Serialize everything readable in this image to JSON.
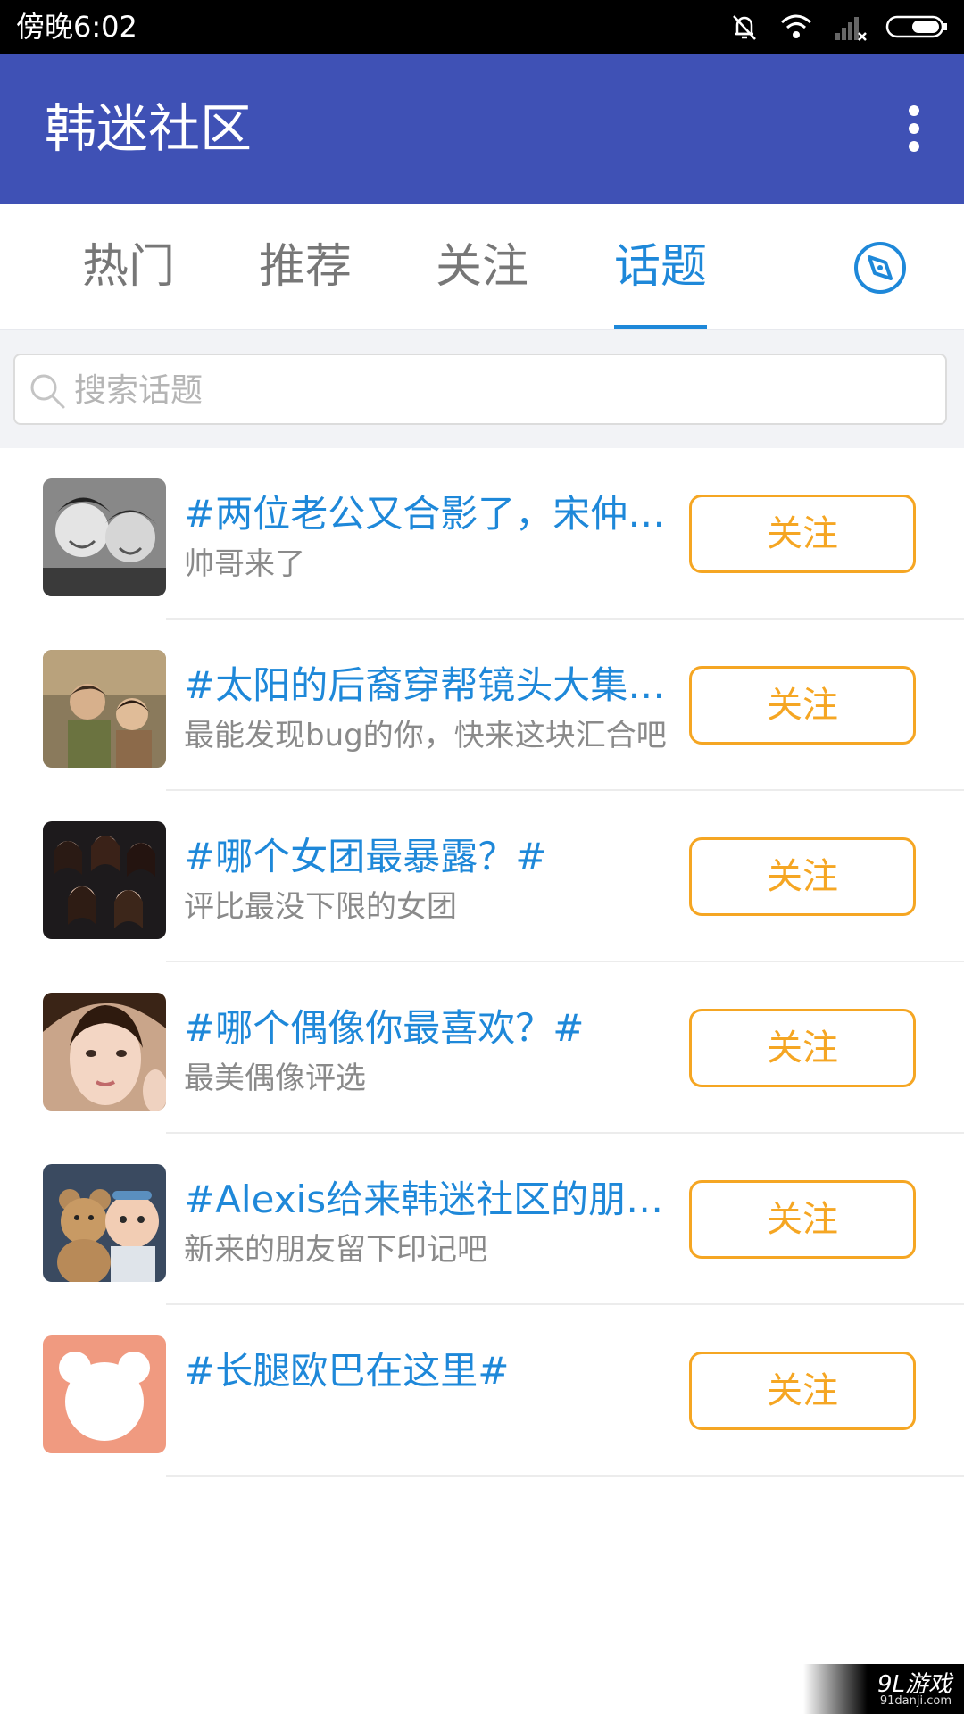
{
  "status_bar": {
    "time": "傍晚6:02"
  },
  "app_bar": {
    "title": "韩迷社区"
  },
  "tabs": [
    {
      "label": "热门",
      "active": false
    },
    {
      "label": "推荐",
      "active": false
    },
    {
      "label": "关注",
      "active": false
    },
    {
      "label": "话题",
      "active": true
    }
  ],
  "search": {
    "placeholder": "搜索话题",
    "value": ""
  },
  "topics": [
    {
      "title": "#两位老公又合影了，宋仲基朴宝剑#",
      "subtitle": "帅哥来了",
      "follow_label": "关注",
      "avatar": "photo-two-men"
    },
    {
      "title": "#太阳的后裔穿帮镜头大集合#",
      "subtitle": "最能发现bug的你，快来这块汇合吧",
      "follow_label": "关注",
      "avatar": "photo-drama-scene"
    },
    {
      "title": "#哪个女团最暴露？#",
      "subtitle": "评比最没下限的女团",
      "follow_label": "关注",
      "avatar": "photo-girl-group"
    },
    {
      "title": "#哪个偶像你最喜欢？#",
      "subtitle": "最美偶像评选",
      "follow_label": "关注",
      "avatar": "photo-actress"
    },
    {
      "title": "#Alexis给来韩迷社区的朋友留言#",
      "subtitle": "新来的朋友留下印记吧",
      "follow_label": "关注",
      "avatar": "photo-baby-teddy"
    },
    {
      "title": "#长腿欧巴在这里#",
      "subtitle": "",
      "follow_label": "关注",
      "avatar": "bear-icon"
    }
  ],
  "watermark": {
    "brand": "9L游戏",
    "site": "91danji.com"
  },
  "colors": {
    "app_bar": "#3f51b5",
    "accent_blue": "#1e88d9",
    "follow_orange": "#f5a623"
  }
}
